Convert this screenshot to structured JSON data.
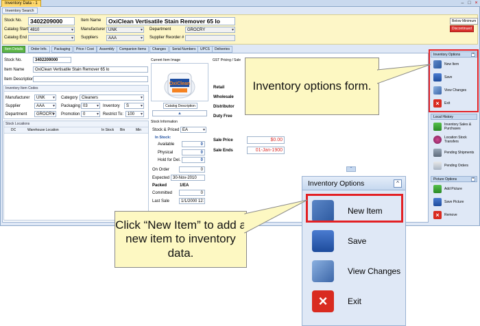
{
  "window": {
    "tab_title": "Inventory Data - 1",
    "subtab": "Inventory Search",
    "buttons": [
      "–",
      "□",
      "×"
    ]
  },
  "header": {
    "stock_no_label": "Stock No.",
    "stock_no": "3402209000",
    "item_name_label": "Item Name",
    "item_name": "OxiClean Vertisatile Stain Remover 65 lo",
    "catalog_start_label": "Catalog Start",
    "catalog_start": "4810",
    "catalog_end_label": "Catalog End",
    "catalog_end": "",
    "manufacturer_label": "Manufacturer",
    "manufacturer": "UNK",
    "suppliers_label": "Suppliers",
    "suppliers": "AAA",
    "department_label": "Department",
    "department": "GROCRY",
    "supplier_reorder_label": "Supplier Reorder #",
    "supplier_reorder": "",
    "badge_min": "Below Minimum",
    "badge_disc": "Discontinued"
  },
  "tabs": [
    "Item Details",
    "Order Info.",
    "Packaging",
    "Price / Cost",
    "Assembly",
    "Companion Items",
    "Changes",
    "Serial Numbers",
    "UPCS",
    "Deliveries"
  ],
  "details": {
    "stock_no_label": "Stock No.",
    "stock_no": "3402209000",
    "item_name_label": "Item Name",
    "item_name": "OxiClean Vertisatile Stain Remover 65 lo",
    "item_desc_label": "Item Description",
    "codes_title": "Inventory Item Codes",
    "manufacturer_label": "Manufacturer",
    "manufacturer": "UNK",
    "category_label": "Category",
    "category": "Cleaners",
    "supplier_label": "Supplier",
    "supplier": "AAA",
    "packaging_label": "Packaging",
    "packaging": "03",
    "inventory_label": "Inventory",
    "inventory": "S",
    "department_label": "Department",
    "department": "GROCRY",
    "promotion_label": "Promotion",
    "promotion": "0",
    "restrict_label": "Restrict To:",
    "restrict": "100",
    "locations_title": "Stock Locations",
    "loc_cols": [
      "DC",
      "Warehouse Location",
      "In Stock",
      "Bin",
      "Min"
    ]
  },
  "image_panel": {
    "title": "Current Item Image",
    "catalog_btn": "Catalog Description",
    "brand": "OxiClean"
  },
  "stock_info": {
    "title": "Stock Information",
    "stock_priced_label": "Stock & Priced",
    "stock_priced": "EA",
    "in_stock_label": "In Stock:",
    "available_label": "Available",
    "available": "0",
    "physical_label": "Physical",
    "physical": "0",
    "hold_label": "Hold for Del.",
    "hold": "0",
    "on_order_label": "On Order",
    "on_order": "0",
    "expected_label": "Expected",
    "expected": "30-Nov-2010",
    "packed_label": "Packed",
    "packed": "1/EA",
    "committed_label": "Committed",
    "committed": "0",
    "last_sale_label": "Last Sale",
    "last_sale": "1/1/2000 12:"
  },
  "pricing": {
    "title": "GST Pricing / Sale",
    "retail_label": "Retail",
    "wholesale_label": "Wholesale",
    "distributor_label": "Distributor",
    "duty_free_label": "Duty Free",
    "sale_price_label": "Sale Price",
    "sale_price": "$0.00",
    "sale_ends_label": "Sale Ends",
    "sale_ends": "01-Jan-1900"
  },
  "sidebar": {
    "options_title": "Inventory Options",
    "options": [
      {
        "label": "New Item",
        "icon": "new-item-icon"
      },
      {
        "label": "Save",
        "icon": "save-icon"
      },
      {
        "label": "View Changes",
        "icon": "view-changes-icon"
      },
      {
        "label": "Exit",
        "icon": "exit-icon"
      }
    ],
    "history_title": "Local History",
    "history": [
      {
        "label": "Inventory Sales & Purchases"
      },
      {
        "label": "Location Stock Transfers"
      },
      {
        "label": "Pending Shipments"
      },
      {
        "label": "Pending Orders"
      }
    ],
    "picture_title": "Picture Options",
    "picture": [
      {
        "label": "Add Picture"
      },
      {
        "label": "Save Picture"
      },
      {
        "label": "Remove"
      }
    ]
  },
  "callouts": {
    "top": "Inventory options form.",
    "bottom": "Click “New Item” to add a new item to inventory data."
  },
  "zoom": {
    "title": "Inventory Options",
    "items": [
      "New Item",
      "Save",
      "View Changes",
      "Exit"
    ]
  },
  "colors": {
    "highlight": "#e32024",
    "callout_bg": "#fdf8c2",
    "active_tab": "#5cb547",
    "header_bg": "#fdf6c7"
  }
}
